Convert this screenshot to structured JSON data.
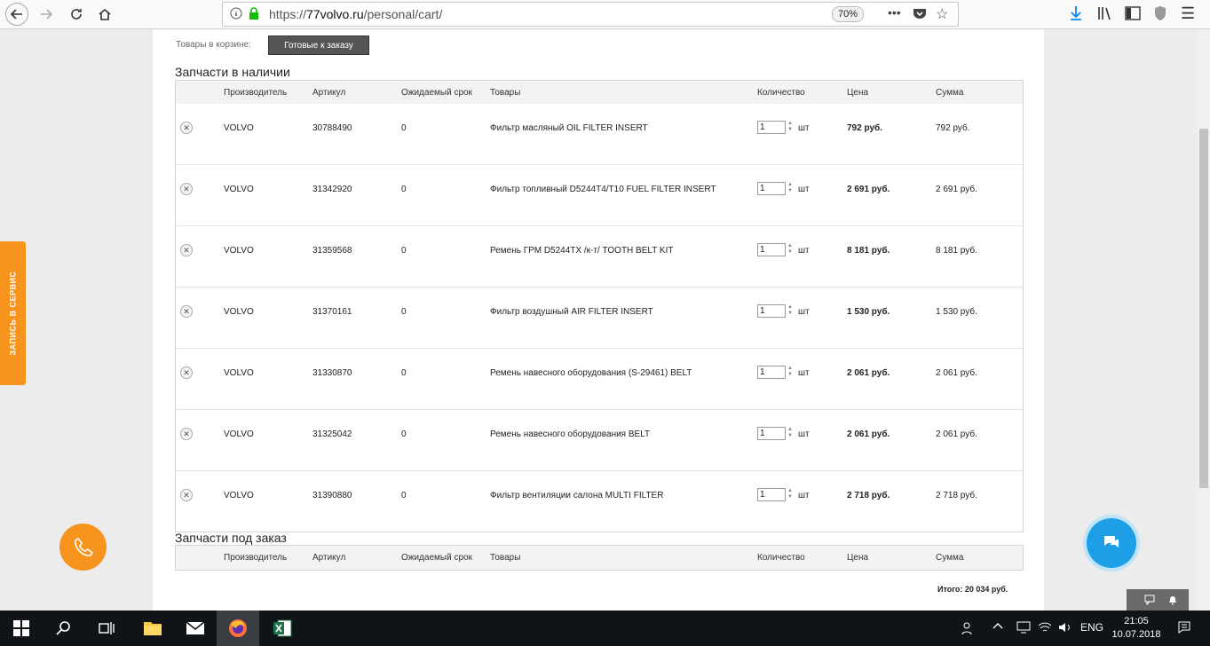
{
  "browser": {
    "url_prefix": "https://",
    "url_host": "77volvo.ru",
    "url_path": "/personal/cart/",
    "zoom": "70%"
  },
  "cart": {
    "label": "Товары в корзине:",
    "ready_button": "Готовые к заказу"
  },
  "in_stock": {
    "title": "Запчасти в наличии",
    "headers": [
      "Производитель",
      "Артикул",
      "Ожидаемый срок",
      "Товары",
      "Количество",
      "Цена",
      "Сумма"
    ],
    "rows": [
      {
        "maker": "VOLVO",
        "article": "30788490",
        "term": "0",
        "product": "Фильтр масляный OIL FILTER INSERT",
        "qty": "1",
        "unit": "шт",
        "price": "792 руб.",
        "sum": "792 руб."
      },
      {
        "maker": "VOLVO",
        "article": "31342920",
        "term": "0",
        "product": "Фильтр топливный D5244T4/T10 FUEL FILTER INSERT",
        "qty": "1",
        "unit": "шт",
        "price": "2 691 руб.",
        "sum": "2 691 руб."
      },
      {
        "maker": "VOLVO",
        "article": "31359568",
        "term": "0",
        "product": "Ремень ГРМ D5244TX /к-т/ TOOTH BELT KIT",
        "qty": "1",
        "unit": "шт",
        "price": "8 181 руб.",
        "sum": "8 181 руб."
      },
      {
        "maker": "VOLVO",
        "article": "31370161",
        "term": "0",
        "product": "Фильтр воздушный AIR FILTER INSERT",
        "qty": "1",
        "unit": "шт",
        "price": "1 530 руб.",
        "sum": "1 530 руб."
      },
      {
        "maker": "VOLVO",
        "article": "31330870",
        "term": "0",
        "product": "Ремень навесного оборудования (S-29461) BELT",
        "qty": "1",
        "unit": "шт",
        "price": "2 061 руб.",
        "sum": "2 061 руб."
      },
      {
        "maker": "VOLVO",
        "article": "31325042",
        "term": "0",
        "product": "Ремень навесного оборудования BELT",
        "qty": "1",
        "unit": "шт",
        "price": "2 061 руб.",
        "sum": "2 061 руб."
      },
      {
        "maker": "VOLVO",
        "article": "31390880",
        "term": "0",
        "product": "Фильтр вентиляции салона MULTI FILTER",
        "qty": "1",
        "unit": "шт",
        "price": "2 718 руб.",
        "sum": "2 718 руб."
      }
    ]
  },
  "on_order": {
    "title": "Запчасти под заказ",
    "headers": [
      "Производитель",
      "Артикул",
      "Ожидаемый срок",
      "Товары",
      "Количество",
      "Цена",
      "Сумма"
    ]
  },
  "total": "Итого: 20 034 руб.",
  "side_tab": "ЗАПИСЬ В СЕРВИС",
  "taskbar": {
    "lang": "ENG",
    "time": "21:05",
    "date": "10.07.2018"
  },
  "colors": {
    "accent_orange": "#f7941d",
    "chat_blue": "#1e9ee6"
  }
}
